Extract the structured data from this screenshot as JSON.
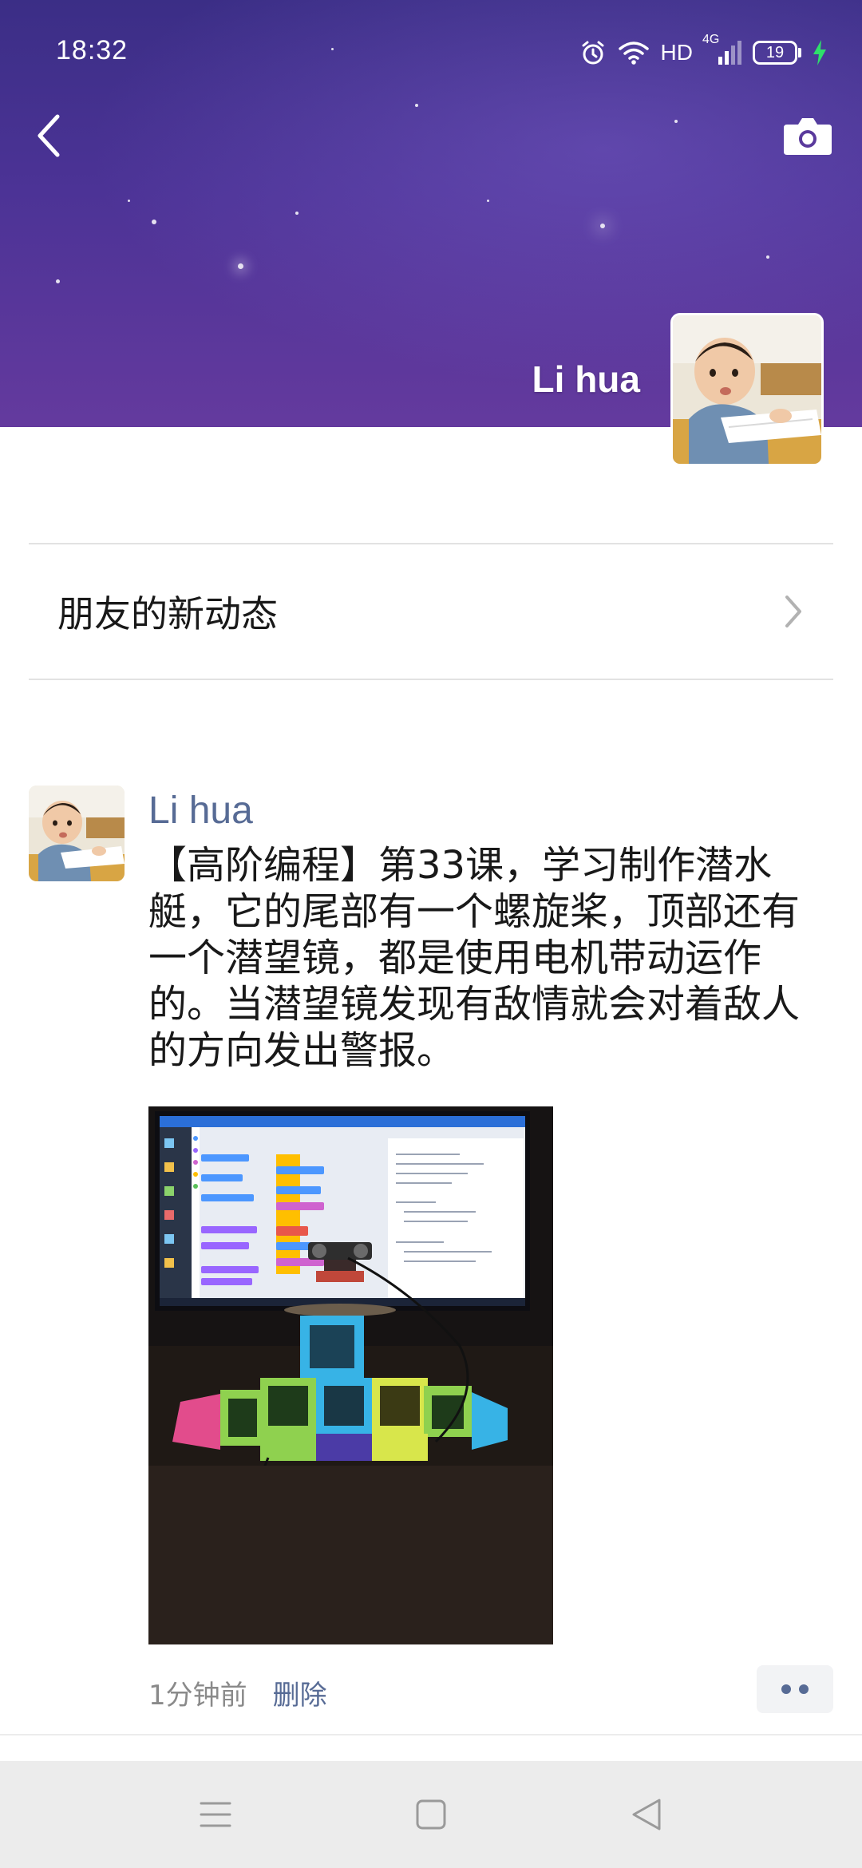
{
  "status_bar": {
    "time": "18:32",
    "network_label": "HD",
    "signal_label": "4G",
    "battery": "19"
  },
  "header": {
    "owner_name": "Li hua",
    "icons": [
      "back-icon",
      "camera-icon"
    ]
  },
  "friends_updates": {
    "label": "朋友的新动态"
  },
  "post": {
    "author": "Li hua",
    "text": "【高阶编程】第33课，学习制作潜水艇，它的尾部有一个螺旋桨，顶部还有一个潜望镜，都是使用电机带动运作的。当潜望镜发现有敌情就会对着敌人的方向发出警报。",
    "time": "1分钟前",
    "delete_label": "删除"
  },
  "colors": {
    "link": "#576b95",
    "cover_top": "#3b2e86",
    "cover_bottom": "#643a9e"
  }
}
